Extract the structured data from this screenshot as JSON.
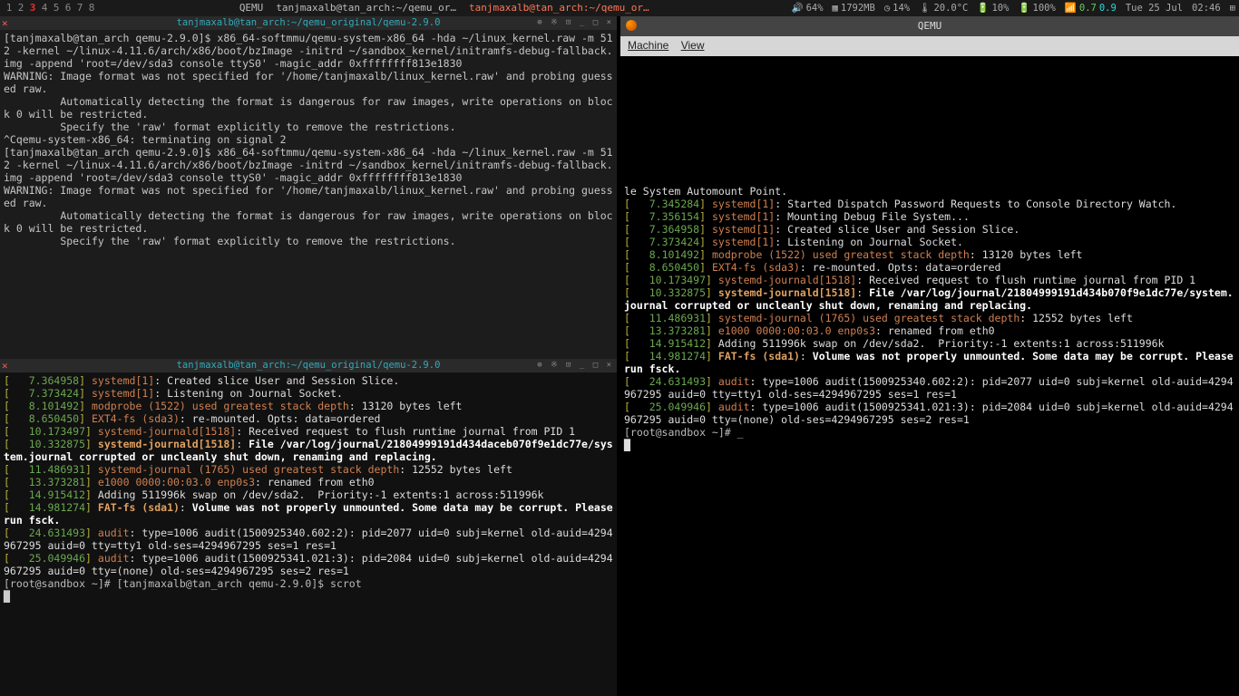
{
  "taskbar": {
    "workspaces": [
      "1",
      "2",
      "3",
      "4",
      "5",
      "6",
      "7",
      "8"
    ],
    "active_ws": 2,
    "center": {
      "label1": "QEMU",
      "label2": "tanjmaxalb@tan_arch:~/qemu_or…",
      "label3": "tanjmaxalb@tan_arch:~/qemu_or…"
    },
    "right": {
      "vol": "64%",
      "mem": "1792MB",
      "cpu": "14%",
      "temp": "20.0°C",
      "bat1": "10%",
      "bat2": "100%",
      "net_down": "0.7",
      "net_up": "0.9",
      "date": "Tue 25 Jul",
      "time": "02:46"
    }
  },
  "top_term": {
    "title": "tanjmaxalb@tan_arch:~/qemu_original/qemu-2.9.0",
    "body": "[tanjmaxalb@tan_arch qemu-2.9.0]$ x86_64-softmmu/qemu-system-x86_64 -hda ~/linux_kernel.raw -m 512 -kernel ~/linux-4.11.6/arch/x86/boot/bzImage -initrd ~/sandbox_kernel/initramfs-debug-fallback.img -append 'root=/dev/sda3 console ttyS0' -magic_addr 0xffffffff813e1830\nWARNING: Image format was not specified for '/home/tanjmaxalb/linux_kernel.raw' and probing guessed raw.\n         Automatically detecting the format is dangerous for raw images, write operations on block 0 will be restricted.\n         Specify the 'raw' format explicitly to remove the restrictions.\n^Cqemu-system-x86_64: terminating on signal 2\n[tanjmaxalb@tan_arch qemu-2.9.0]$ x86_64-softmmu/qemu-system-x86_64 -hda ~/linux_kernel.raw -m 512 -kernel ~/linux-4.11.6/arch/x86/boot/bzImage -initrd ~/sandbox_kernel/initramfs-debug-fallback.img -append 'root=/dev/sda3 console ttyS0' -magic_addr 0xffffffff813e1830\nWARNING: Image format was not specified for '/home/tanjmaxalb/linux_kernel.raw' and probing guessed raw.\n         Automatically detecting the format is dangerous for raw images, write operations on block 0 will be restricted.\n         Specify the 'raw' format explicitly to remove the restrictions."
  },
  "bot_term": {
    "title": "tanjmaxalb@tan_arch:~/qemu_original/qemu-2.9.0",
    "lines": [
      {
        "t": "7.364958",
        "s": "systemd[1]",
        "m": ": Created slice User and Session Slice."
      },
      {
        "t": "7.373424",
        "s": "systemd[1]",
        "m": ": Listening on Journal Socket."
      },
      {
        "t": "8.101492",
        "s": "modprobe (1522) used greatest stack depth",
        "m": ": 13120 bytes left"
      },
      {
        "t": "8.650450",
        "s": "EXT4-fs (sda3)",
        "m": ": re-mounted. Opts: data=ordered"
      },
      {
        "t": "10.173497",
        "s": "systemd-journald[1518]",
        "m": ": Received request to flush runtime journal from PID 1"
      },
      {
        "t": "10.332875",
        "s": "systemd-journald[1518]",
        "m": ": ",
        "bold": "File /var/log/journal/21804999191d434daceb070f9e1dc77e/system.journal corrupted or uncleanly shut down, renaming and replacing."
      },
      {
        "t": "11.486931",
        "s": "systemd-journal (1765) used greatest stack depth",
        "m": ": 12552 bytes left"
      },
      {
        "t": "13.373281",
        "s": "e1000 0000:00:03.0 enp0s3",
        "m": ": renamed from eth0"
      },
      {
        "t": "14.915412",
        "s": "",
        "m": "Adding 511996k swap on /dev/sda2.  Priority:-1 extents:1 across:511996k"
      },
      {
        "t": "14.981274",
        "s": "FAT-fs (sda1)",
        "m": ": ",
        "bold": "Volume was not properly unmounted. Some data may be corrupt. Please run fsck."
      },
      {
        "t": "24.631493",
        "s": "audit",
        "m": ": type=1006 audit(1500925340.602:2): pid=2077 uid=0 subj=kernel old-auid=4294967295 auid=0 tty=tty1 old-ses=4294967295 ses=1 res=1"
      },
      {
        "t": "25.049946",
        "s": "audit",
        "m": ": type=1006 audit(1500925341.021:3): pid=2084 uid=0 subj=kernel old-auid=4294967295 auid=0 tty=(none) old-ses=4294967295 ses=2 res=1"
      }
    ],
    "prompt": "[root@sandbox ~]# [tanjmaxalb@tan_arch qemu-2.9.0]$ scrot"
  },
  "qemu": {
    "title": "QEMU",
    "menu": {
      "m1": "Machine",
      "m2": "View"
    },
    "pre": "le System Automount Point.",
    "lines": [
      {
        "t": "7.345284",
        "s": "systemd[1]",
        "m": ": Started Dispatch Password Requests to Console Directory Watch."
      },
      {
        "t": "7.356154",
        "s": "systemd[1]",
        "m": ": Mounting Debug File System..."
      },
      {
        "t": "7.364958",
        "s": "systemd[1]",
        "m": ": Created slice User and Session Slice."
      },
      {
        "t": "7.373424",
        "s": "systemd[1]",
        "m": ": Listening on Journal Socket."
      },
      {
        "t": "8.101492",
        "s": "modprobe (1522) used greatest stack depth",
        "m": ": 13120 bytes left"
      },
      {
        "t": "8.650450",
        "s": "EXT4-fs (sda3)",
        "m": ": re-mounted. Opts: data=ordered"
      },
      {
        "t": "10.173497",
        "s": "systemd-journald[1518]",
        "m": ": Received request to flush runtime journal from PID 1"
      },
      {
        "t": "10.332875",
        "s": "systemd-journald[1518]",
        "m": ": ",
        "bold": "File /var/log/journal/21804999191d434b070f9e1dc77e/system.journal corrupted or uncleanly shut down, renaming and replacing."
      },
      {
        "t": "11.486931",
        "s": "systemd-journal (1765) used greatest stack depth",
        "m": ": 12552 bytes left"
      },
      {
        "t": "13.373281",
        "s": "e1000 0000:00:03.0 enp0s3",
        "m": ": renamed from eth0"
      },
      {
        "t": "14.915412",
        "s": "",
        "m": "Adding 511996k swap on /dev/sda2.  Priority:-1 extents:1 across:511996k"
      },
      {
        "t": "14.981274",
        "s": "FAT-fs (sda1)",
        "m": ": ",
        "bold": "Volume was not properly unmounted. Some data may be corrupt. Please run fsck."
      },
      {
        "t": "24.631493",
        "s": "audit",
        "m": ": type=1006 audit(1500925340.602:2): pid=2077 uid=0 subj=kernel old-auid=4294967295 auid=0 tty=tty1 old-ses=4294967295 ses=1 res=1"
      },
      {
        "t": "25.049946",
        "s": "audit",
        "m": ": type=1006 audit(1500925341.021:3): pid=2084 uid=0 subj=kernel old-auid=4294967295 auid=0 tty=(none) old-ses=4294967295 ses=2 res=1"
      }
    ],
    "prompt": "[root@sandbox ~]# _"
  }
}
